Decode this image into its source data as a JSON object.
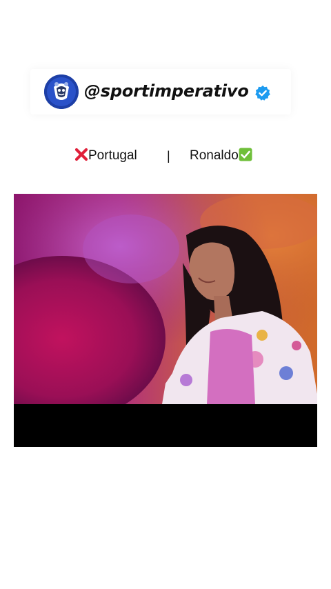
{
  "profile": {
    "handle": "@sportimperativo",
    "verified": true
  },
  "caption": {
    "left_text": "Portugal",
    "left_icon": "cross-mark-icon",
    "separator": "|",
    "right_text": "Ronaldo",
    "right_icon": "check-mark-icon"
  },
  "video": {
    "description_icon": "video-frame"
  },
  "colors": {
    "accent_blue": "#1d9bf0",
    "avatar_blue": "#1d3fa6",
    "cross_red": "#e0203a",
    "check_green": "#6fbf3a"
  }
}
